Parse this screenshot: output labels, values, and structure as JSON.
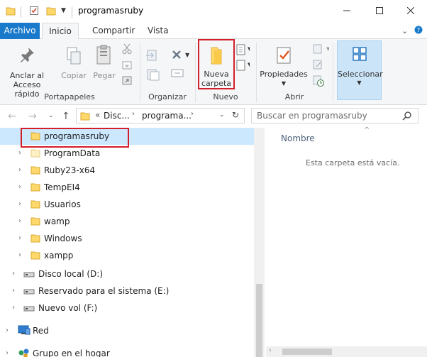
{
  "window": {
    "title": "programasruby"
  },
  "tabs": {
    "file": "Archivo",
    "home": "Inicio",
    "share": "Compartir",
    "view": "Vista"
  },
  "ribbon": {
    "pin_label_1": "Anclar al",
    "pin_label_2": "Acceso rápido",
    "copy": "Copiar",
    "paste": "Pegar",
    "new_folder_1": "Nueva",
    "new_folder_2": "carpeta",
    "properties": "Propiedades",
    "select": "Seleccionar",
    "groups": {
      "clipboard": "Portapapeles",
      "organize": "Organizar",
      "new": "Nuevo",
      "open": "Abrir"
    }
  },
  "address": {
    "overflow": "«",
    "crumb1": "Disc...",
    "crumb2": "programa...",
    "search_placeholder": "Buscar en programasruby"
  },
  "tree": [
    {
      "label": "programasruby",
      "selected": true
    },
    {
      "label": "ProgramData"
    },
    {
      "label": "Ruby23-x64"
    },
    {
      "label": "TempEI4"
    },
    {
      "label": "Usuarios"
    },
    {
      "label": "wamp"
    },
    {
      "label": "Windows"
    },
    {
      "label": "xampp"
    },
    {
      "label": "Disco local (D:)"
    },
    {
      "label": "Reservado para el sistema (E:)"
    },
    {
      "label": "Nuevo vol (F:)"
    },
    {
      "label": "Red"
    },
    {
      "label": "Grupo en el hogar"
    }
  ],
  "content": {
    "column_name": "Nombre",
    "empty_message": "Esta carpeta está vacía."
  },
  "colors": {
    "accent": "#1979ca",
    "selection": "#cce8ff",
    "highlight": "#d21f2a",
    "folder": "#ffd86b"
  }
}
